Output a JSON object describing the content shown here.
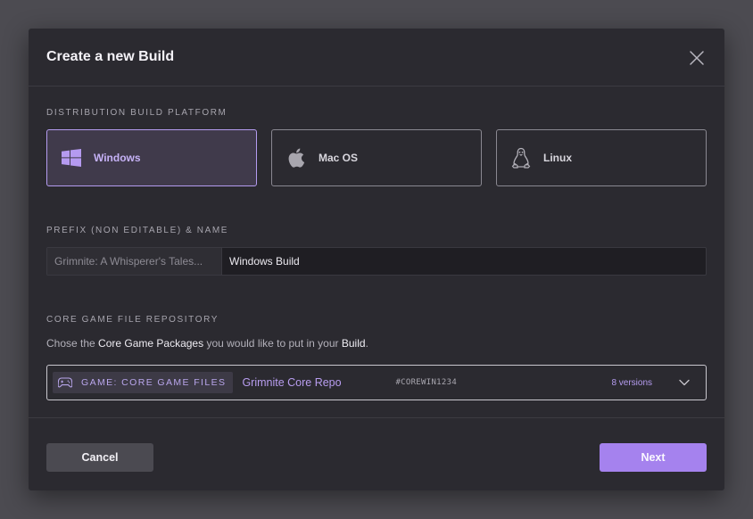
{
  "dialog": {
    "title": "Create a new Build"
  },
  "platform_section": {
    "label": "DISTRIBUTION BUILD PLATFORM",
    "options": [
      {
        "label": "Windows",
        "icon": "windows-icon",
        "selected": true
      },
      {
        "label": "Mac OS",
        "icon": "apple-icon",
        "selected": false
      },
      {
        "label": "Linux",
        "icon": "linux-icon",
        "selected": false
      }
    ]
  },
  "name_section": {
    "label": "PREFIX (NON EDITABLE) & NAME",
    "prefix": "Grimnite: A Whisperer's Tales...",
    "name_value": "Windows Build"
  },
  "repo_section": {
    "label": "CORE GAME FILE REPOSITORY",
    "description": {
      "part1": "Chose the ",
      "highlight1": "Core Game Packages",
      "part2": " you would like to put in your ",
      "highlight2": "Build",
      "part3": "."
    },
    "selected": {
      "tag": "GAME: CORE GAME FILES",
      "tag_icon": "gamepad-icon",
      "name": "Grimnite Core Repo",
      "code": "#COREWIN1234",
      "versions": "8 versions"
    }
  },
  "footer": {
    "cancel_label": "Cancel",
    "next_label": "Next"
  },
  "colors": {
    "accent": "#a582ee",
    "accent_text": "#c6b2f7",
    "modal_bg": "#2b2a30",
    "backdrop": "#4c4b51"
  }
}
